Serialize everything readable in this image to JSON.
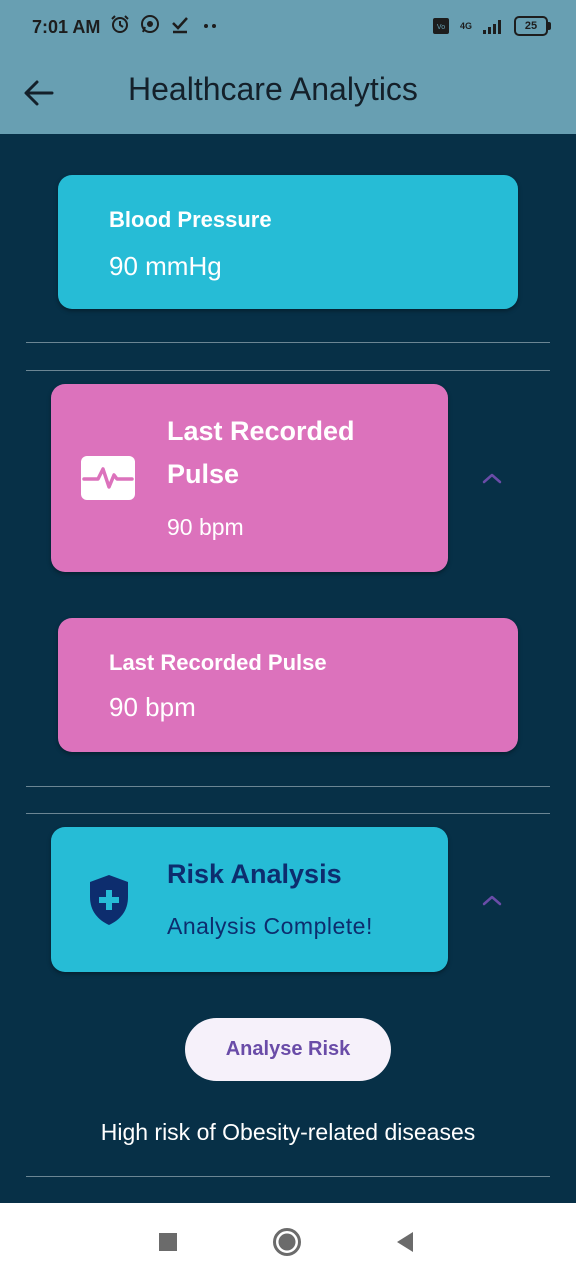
{
  "status_bar": {
    "time": "7:01 AM",
    "icons": [
      "alarm-icon",
      "whatsapp-icon",
      "check-icon",
      "more-dots-icon"
    ],
    "network": "4G",
    "battery": "25"
  },
  "app_bar": {
    "title": "Healthcare Analytics"
  },
  "blood_pressure": {
    "title": "Blood Pressure",
    "value": "90 mmHg"
  },
  "pulse_tile": {
    "title_line1": "Last Recorded",
    "title_line2": "Pulse",
    "value": "90 bpm"
  },
  "pulse_card": {
    "title": "Last Recorded Pulse",
    "value": "90 bpm"
  },
  "risk_tile": {
    "title": "Risk Analysis",
    "subtitle": "Analysis Complete!"
  },
  "analyse_button": {
    "label": "Analyse Risk"
  },
  "risk_result": "High risk of Obesity-related diseases",
  "colors": {
    "background": "#073047",
    "app_bar": "#689fb2",
    "cyan_card": "#26bcd6",
    "pink_card": "#dc72bc",
    "risk_title": "#0d2d6e",
    "chevron": "#6a4ca8"
  }
}
